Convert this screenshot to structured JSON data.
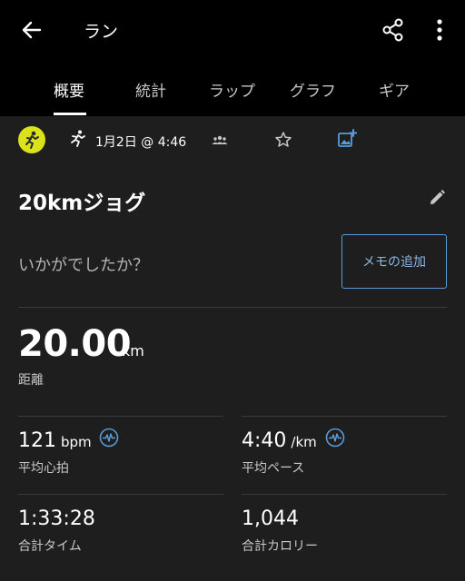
{
  "header": {
    "title": "ラン"
  },
  "tabs": [
    {
      "label": "概要",
      "active": true
    },
    {
      "label": "統計",
      "active": false
    },
    {
      "label": "ラップ",
      "active": false
    },
    {
      "label": "グラフ",
      "active": false
    },
    {
      "label": "ギア",
      "active": false
    }
  ],
  "activity": {
    "date": "1月2日 @ 4:46",
    "name": "20kmジョグ",
    "feedback_prompt": "いかがでしたか？",
    "memo_button": "メモの追加"
  },
  "distance": {
    "value": "20.00",
    "unit": "km",
    "label": "距離"
  },
  "stats": {
    "heart_rate": {
      "value": "121",
      "unit": "bpm",
      "label": "平均心拍"
    },
    "pace": {
      "value": "4:40",
      "unit": "/km",
      "label": "平均ペース"
    },
    "time": {
      "value": "1:33:28",
      "label": "合計タイム"
    },
    "calories": {
      "value": "1,044",
      "label": "合計カロリー"
    }
  },
  "colors": {
    "accent_blue": "#5a9bd8",
    "badge_yellow": "#d9e21a",
    "background": "#1e1e1e",
    "header_bg": "#000000"
  },
  "icons": [
    "back-arrow-icon",
    "share-icon",
    "more-vert-icon",
    "runner-icon",
    "people-icon",
    "star-icon",
    "add-photo-icon",
    "edit-icon",
    "heart-rate-icon"
  ]
}
